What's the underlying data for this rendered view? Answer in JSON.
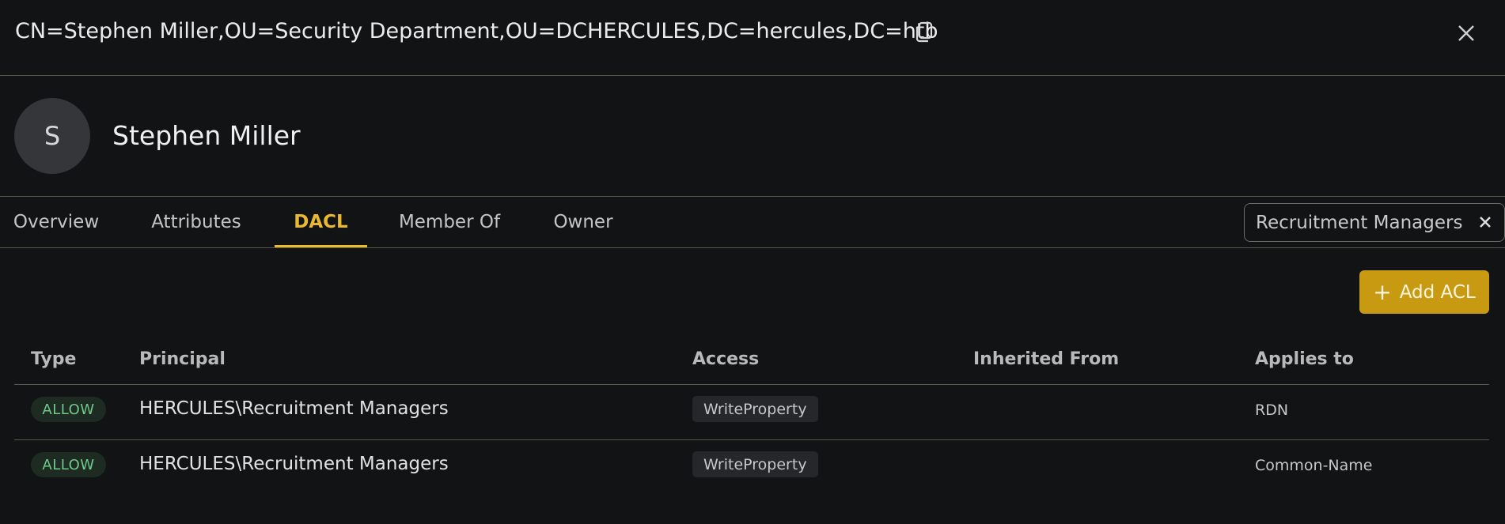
{
  "dialog": {
    "dn": "CN=Stephen Miller,OU=Security Department,OU=DCHERCULES,DC=hercules,DC=htb",
    "icons": {
      "copy": "copy-icon",
      "close": "close-icon",
      "clear": "clear-icon"
    }
  },
  "object": {
    "avatar_initial": "S",
    "name": "Stephen Miller"
  },
  "tabs": [
    {
      "label": "Overview"
    },
    {
      "label": "Attributes"
    },
    {
      "label": "DACL",
      "active": true
    },
    {
      "label": "Member Of"
    },
    {
      "label": "Owner"
    }
  ],
  "filter": {
    "value": "Recruitment Managers"
  },
  "toolbar": {
    "add_acl_label": "Add ACL",
    "add_icon": "+"
  },
  "table": {
    "headers": [
      "Type",
      "Principal",
      "Access",
      "Inherited From",
      "Applies to"
    ],
    "rows": [
      {
        "type": "ALLOW",
        "principal": "HERCULES\\Recruitment Managers",
        "access": "WriteProperty",
        "inherited_from": "",
        "applies_to": "RDN"
      },
      {
        "type": "ALLOW",
        "principal": "HERCULES\\Recruitment Managers",
        "access": "WriteProperty",
        "inherited_from": "",
        "applies_to": "Common-Name"
      }
    ]
  },
  "colors": {
    "accent": "#e8b931",
    "button": "#c89a12",
    "allow_text": "#6fc98a",
    "background": "#121314"
  }
}
